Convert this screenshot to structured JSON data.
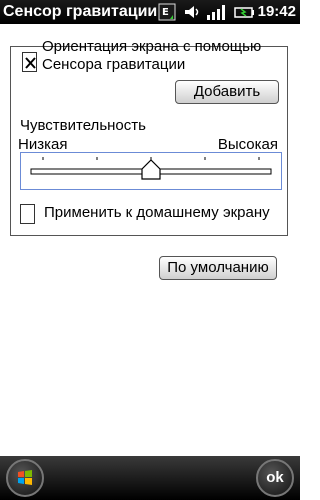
{
  "statusbar": {
    "title": "Сенсор гравитации",
    "time": "19:42",
    "indicator": "E",
    "icons": [
      "network-e-icon",
      "volume-icon",
      "signal-icon",
      "battery-icon"
    ]
  },
  "settings": {
    "orientation_checked": true,
    "orientation_line1": "Ориентация экрана с помощью",
    "orientation_line2": "Сенсора гравитации",
    "add_button": "Добавить",
    "sensitivity_label": "Чувствительность",
    "sensitivity_low": "Низкая",
    "sensitivity_high": "Высокая",
    "sensitivity_value": 0.5,
    "home_screen_checked": false,
    "home_screen_label": "Применить к домашнему экрану"
  },
  "default_button": "По умолчанию",
  "bottombar": {
    "start_icon": "windows-start-icon",
    "ok_label": "ok"
  }
}
